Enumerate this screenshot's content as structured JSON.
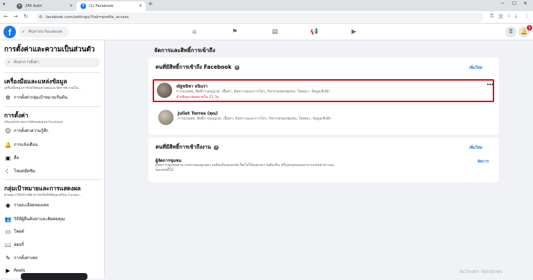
{
  "browser": {
    "tabs": [
      {
        "label": "2FA Auth"
      },
      {
        "label": "(1) Facebook"
      }
    ],
    "new_tab": "+",
    "url": "facebook.com/settings/?tab=profile_access"
  },
  "fbnav": {
    "logo": "f",
    "search_placeholder": "ค้นหาบน Facebook",
    "notification_count": "1"
  },
  "sidebar": {
    "title": "การตั้งค่าและความเป็นส่วนตัว",
    "search_placeholder": "ค้นหาการตั้งค่า",
    "sections": [
      {
        "title": "เครื่องมือและแหล่งข้อมูล",
        "desc": "เครื่องมือของเราช่วยให้คุณควบคุมและจัดการความเป็น...",
        "items": [
          {
            "label": "การตั้งค่ากลุ่มเป้าหมายเริ่มต้น"
          }
        ]
      },
      {
        "title": "การตั้งค่า",
        "desc": "ปรับแต่งประสบการณ์ของคุณบน Facebook",
        "items": [
          {
            "label": "การตั้งค่าความรู้สึก"
          },
          {
            "label": "การแจ้งเตือน"
          },
          {
            "label": "สื่อ"
          },
          {
            "label": "โหมดมืดชิม"
          }
        ]
      },
      {
        "title": "กลุ่มเป้าหมายและการแสดงผล",
        "desc": "ควบคุมว่าใครบ้างที่สามารถเห็นสิ่งที่คุณแชร์บน Facebo...",
        "items": [
          {
            "label": "รายละเอียดของเพจ"
          },
          {
            "label": "วิธีที่ผู้อื่นค้นหาและติดต่อคุณ"
          },
          {
            "label": "โพสต์"
          },
          {
            "label": "สตอรี่"
          },
          {
            "label": "การตั้งค่าเพจ"
          },
          {
            "label": "Reels"
          }
        ]
      }
    ]
  },
  "main": {
    "heading": "จัดการและสิทธิ์การเข้าถึง",
    "facebook_access": {
      "title": "คนที่มีสิทธิ์การเข้าถึง Facebook",
      "add_label": "เพิ่มใหม่",
      "people": [
        {
          "name": "ณัฐชนิชา ธนินรา",
          "permissions": "การแบนพจ, สิทธิ์การอนุญาต, เนื้อหา, ข้อความและการโทร, กิจกรรมของชุมชน, โฆษณา, ข้อมูลเชิงลึก",
          "expiry": "คำเชิญจะหมดอายุใน 21 วัน"
        },
        {
          "name": "Juliet Torres (คุณ)",
          "permissions": "การแบนพจ, สิทธิ์การอนุญาต, เนื้อหา, ข้อความและการโทร, กิจกรรมของชุมชน, โฆษณา, ข้อมูลเชิงลึก",
          "expiry": ""
        }
      ]
    },
    "task_access": {
      "title": "คนที่มีสิทธิ์การเข้าถึงงาน",
      "add_label": "เพิ่มใหม่",
      "manager_label": "ผู้จัดการชุมชน",
      "manager_desc": "ผู้จัดการชุมชนสามารถควบคุมดูแลความคิดเห็นของแชท ปิดไม่ให้แสดงความคิดเห็น หรือลบบุคคลออกจากแชทสาธารณะของเพจนี้ได้",
      "manage_label": "จัดการ"
    }
  },
  "watermark": "Activate Windows"
}
